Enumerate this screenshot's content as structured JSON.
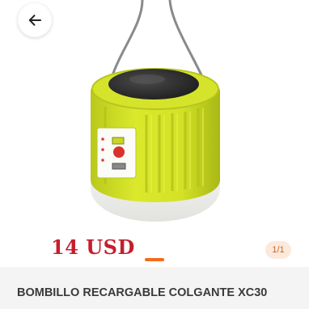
{
  "header": {
    "back_icon": "arrow-left-icon"
  },
  "gallery": {
    "image_subject": "solar-lantern-image",
    "image_overlay_text": "14 USD",
    "current_page": 1,
    "total_pages": 1,
    "page_counter": "1/1",
    "indicator_color": "#f26b1d"
  },
  "product": {
    "title": "BOMBILLO RECARGABLE COLGANTE XC30",
    "accent_color": "#d7e82a",
    "price_color": "#c41e2e"
  }
}
